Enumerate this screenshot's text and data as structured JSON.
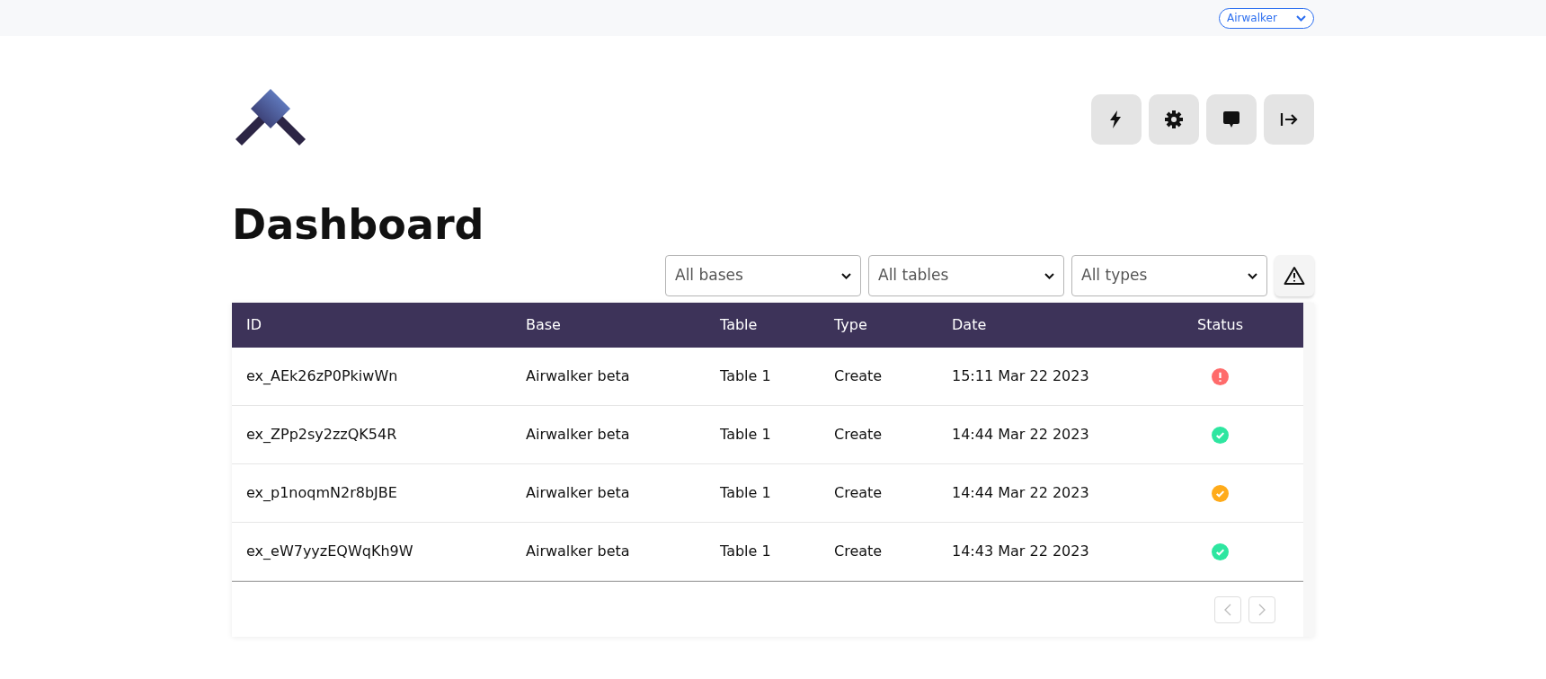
{
  "top_bar": {
    "account_select": "Airwalker"
  },
  "header_buttons": [
    {
      "kind": "bolt"
    },
    {
      "kind": "gear"
    },
    {
      "kind": "chat"
    },
    {
      "kind": "logout"
    }
  ],
  "title": "Dashboard",
  "filters": [
    {
      "value": "All bases"
    },
    {
      "value": "All tables"
    },
    {
      "value": "All types"
    }
  ],
  "table": {
    "columns": [
      "ID",
      "Base",
      "Table",
      "Type",
      "Date",
      "Status"
    ],
    "rows": [
      {
        "id": "ex_AEk26zP0PkiwWn",
        "base": "Airwalker beta",
        "table": "Table 1",
        "type": "Create",
        "date": "15:11 Mar 22 2023",
        "status": {
          "kind": "error",
          "color": "#ff6b6b"
        }
      },
      {
        "id": "ex_ZPp2sy2zzQK54R",
        "base": "Airwalker beta",
        "table": "Table 1",
        "type": "Create",
        "date": "14:44 Mar 22 2023",
        "status": {
          "kind": "ok",
          "color": "#2ee6a0"
        }
      },
      {
        "id": "ex_p1noqmN2r8bJBE",
        "base": "Airwalker beta",
        "table": "Table 1",
        "type": "Create",
        "date": "14:44 Mar 22 2023",
        "status": {
          "kind": "ok",
          "color": "#ffab1a"
        }
      },
      {
        "id": "ex_eW7yyzEQWqKh9W",
        "base": "Airwalker beta",
        "table": "Table 1",
        "type": "Create",
        "date": "14:43 Mar 22 2023",
        "status": {
          "kind": "ok",
          "color": "#2ee6a0"
        }
      }
    ]
  },
  "pagination": {
    "prev_disabled": true,
    "next_disabled": true
  }
}
